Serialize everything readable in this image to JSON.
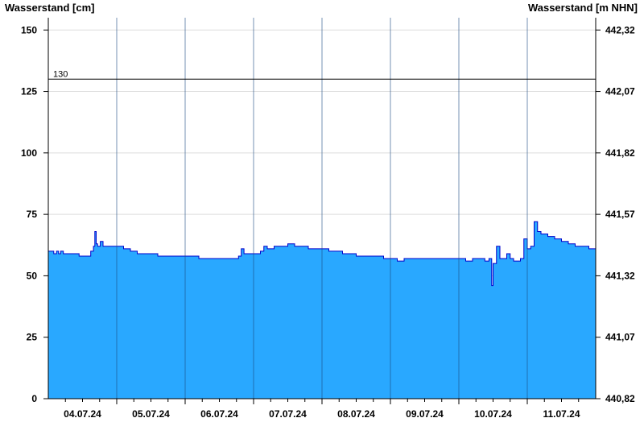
{
  "chart_data": {
    "type": "area",
    "ylabel_left": "Wasserstand [cm]",
    "ylabel_right": "Wasserstand [m NHN]",
    "ylim": [
      0,
      155
    ],
    "yticks_left": [
      0,
      25,
      50,
      75,
      100,
      125,
      150
    ],
    "yticks_right": [
      "440,82",
      "441,07",
      "441,32",
      "441,57",
      "441,82",
      "442,07",
      "442,32"
    ],
    "xlim": [
      0,
      8
    ],
    "x_day_labels": [
      "04.07.24",
      "05.07.24",
      "06.07.24",
      "07.07.24",
      "08.07.24",
      "09.07.24",
      "10.07.24",
      "11.07.24"
    ],
    "reference_line": {
      "value": 130,
      "label": "130"
    },
    "grid": true,
    "fill_color": "#29a8ff",
    "line_color": "#0000cc",
    "series": [
      {
        "x": [
          0.0,
          0.08,
          0.12,
          0.15,
          0.18,
          0.22,
          0.3,
          0.45,
          0.55,
          0.62,
          0.66,
          0.68,
          0.7,
          0.72,
          0.76,
          0.8,
          0.85,
          0.9,
          1.0,
          1.1,
          1.2,
          1.3,
          1.4,
          1.5,
          1.6,
          1.7,
          1.8,
          1.9,
          2.0,
          2.1,
          2.2,
          2.3,
          2.4,
          2.5,
          2.6,
          2.7,
          2.78,
          2.82,
          2.86,
          2.9,
          3.0,
          3.1,
          3.15,
          3.2,
          3.3,
          3.4,
          3.5,
          3.6,
          3.7,
          3.8,
          3.9,
          4.0,
          4.1,
          4.2,
          4.3,
          4.4,
          4.5,
          4.6,
          4.7,
          4.8,
          4.9,
          5.0,
          5.1,
          5.2,
          5.3,
          5.4,
          5.5,
          5.6,
          5.7,
          5.8,
          5.9,
          6.0,
          6.1,
          6.2,
          6.3,
          6.38,
          6.44,
          6.48,
          6.5,
          6.55,
          6.6,
          6.65,
          6.7,
          6.75,
          6.8,
          6.9,
          6.95,
          7.0,
          7.05,
          7.1,
          7.15,
          7.2,
          7.25,
          7.3,
          7.4,
          7.5,
          7.6,
          7.7,
          7.8,
          7.9,
          8.0
        ],
        "y": [
          60,
          59,
          60,
          59,
          60,
          59,
          59,
          58,
          58,
          60,
          62,
          68,
          63,
          62,
          64,
          62,
          62,
          62,
          62,
          61,
          60,
          59,
          59,
          59,
          58,
          58,
          58,
          58,
          58,
          58,
          57,
          57,
          57,
          57,
          57,
          57,
          58,
          61,
          59,
          59,
          59,
          60,
          62,
          61,
          62,
          62,
          63,
          62,
          62,
          61,
          61,
          61,
          60,
          60,
          59,
          59,
          58,
          58,
          58,
          58,
          57,
          57,
          56,
          57,
          57,
          57,
          57,
          57,
          57,
          57,
          57,
          57,
          56,
          57,
          57,
          56,
          57,
          46,
          55,
          62,
          57,
          57,
          59,
          57,
          56,
          57,
          65,
          61,
          62,
          72,
          68,
          67,
          67,
          66,
          65,
          64,
          63,
          62,
          62,
          61,
          61
        ]
      }
    ]
  }
}
